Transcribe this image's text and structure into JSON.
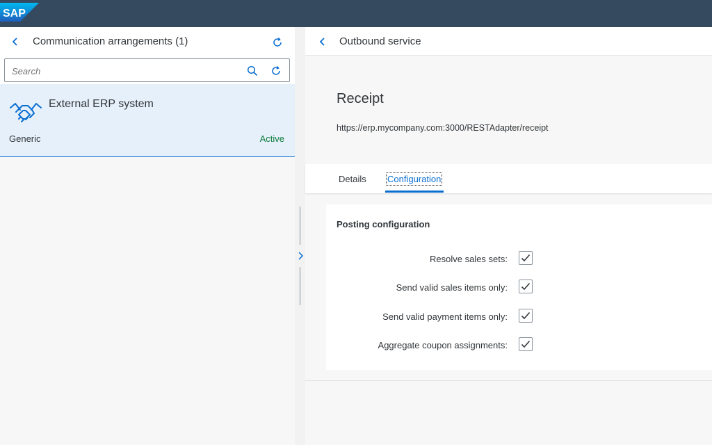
{
  "shell": {
    "logo_text": "SAP",
    "brand_color": "#354a5f"
  },
  "master": {
    "title": "Communication arrangements (1)",
    "search": {
      "placeholder": "Search",
      "value": ""
    },
    "items": [
      {
        "icon": "handshake-icon",
        "title": "External ERP system",
        "subtitle": "Generic",
        "status": "Active",
        "status_color": "#107e3e"
      }
    ]
  },
  "detail": {
    "title": "Outbound service",
    "object": {
      "title": "Receipt",
      "url": "https://erp.mycompany.com:3000/RESTAdapter/receipt"
    },
    "tabs": [
      {
        "label": "Details",
        "selected": false
      },
      {
        "label": "Configuration",
        "selected": true
      }
    ],
    "section": {
      "title": "Posting configuration",
      "fields": [
        {
          "label": "Resolve sales sets:",
          "checked": true
        },
        {
          "label": "Send valid sales items only:",
          "checked": true
        },
        {
          "label": "Send valid payment items only:",
          "checked": true
        },
        {
          "label": "Aggregate coupon assignments:",
          "checked": true
        }
      ]
    }
  },
  "colors": {
    "accent": "#0a6ed1",
    "selection_bg": "#e5f0fa",
    "success": "#107e3e"
  }
}
